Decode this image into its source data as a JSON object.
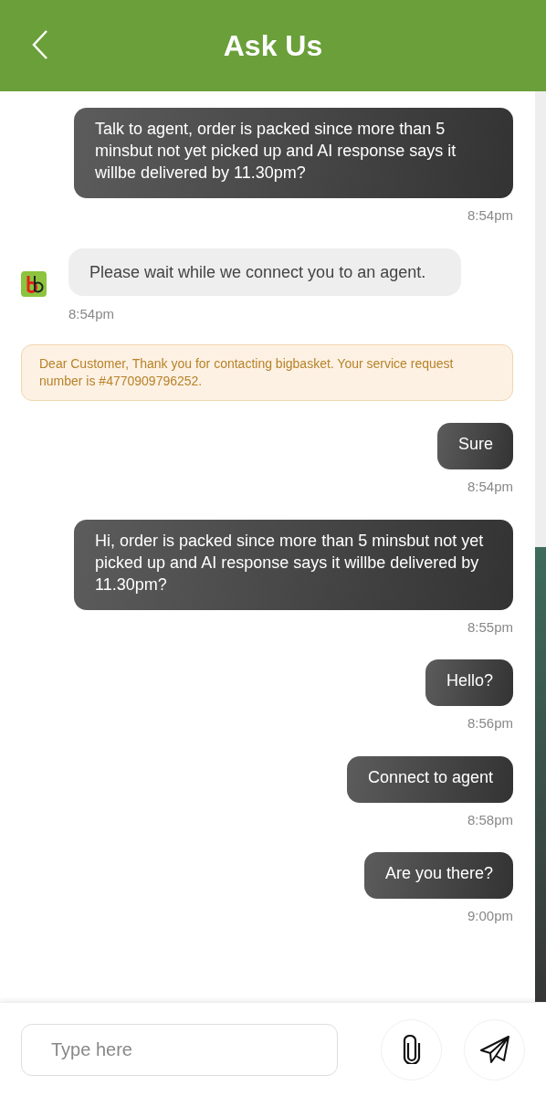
{
  "header": {
    "title": "Ask Us"
  },
  "messages": [
    {
      "kind": "user",
      "text": "Talk to agent, order is packed since more than 5 minsbut not yet picked up and AI response says it willbe delivered by 11.30pm?",
      "time": "8:54pm"
    },
    {
      "kind": "agent",
      "text": "Please wait while we connect you to an agent.",
      "time": "8:54pm"
    },
    {
      "kind": "notice",
      "text": "Dear Customer, Thank you for contacting bigbasket. Your service request number is #4770909796252."
    },
    {
      "kind": "user",
      "text": "Sure",
      "time": "8:54pm"
    },
    {
      "kind": "user",
      "text": "Hi, order is packed since more than 5 minsbut not yet picked up and AI response says it willbe delivered by 11.30pm?",
      "time": "8:55pm"
    },
    {
      "kind": "user",
      "text": "Hello?",
      "time": "8:56pm"
    },
    {
      "kind": "user",
      "text": "Connect to agent",
      "time": "8:58pm"
    },
    {
      "kind": "user",
      "text": "Are you there?",
      "time": "9:00pm"
    }
  ],
  "composer": {
    "placeholder": "Type here"
  }
}
